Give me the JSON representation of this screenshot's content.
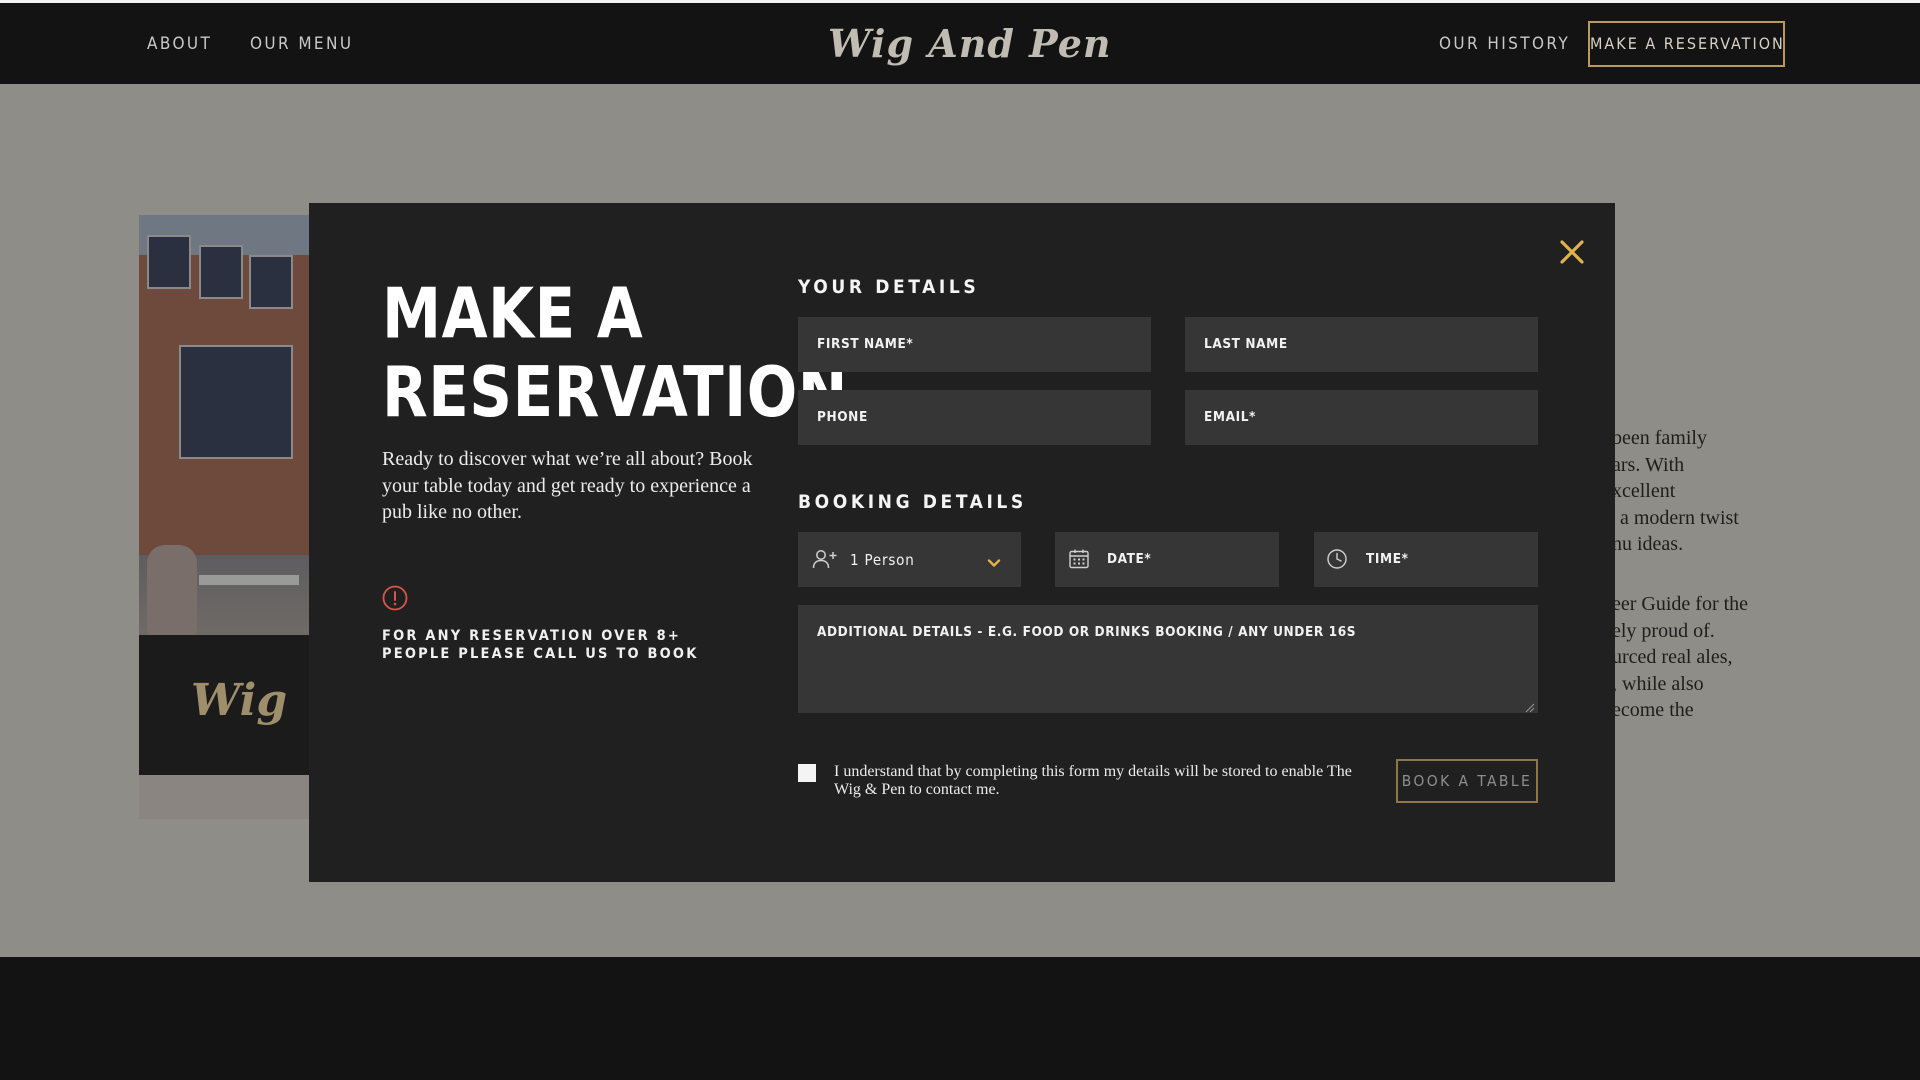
{
  "nav": {
    "left_links": [
      "ABOUT",
      "OUR MENU"
    ],
    "logo_text": "Wig And Pen",
    "right_link": "OUR HISTORY",
    "cta_label": "MAKE A RESERVATION"
  },
  "background": {
    "photo_sign_text": "Wig",
    "paragraph_1": [
      "been family",
      "ars. With",
      "xcellent",
      "a modern twist",
      "nu ideas."
    ],
    "paragraph_2": [
      "eer Guide for the",
      "ely proud of.",
      "urced real ales,",
      ", while also",
      "ecome the"
    ]
  },
  "modal": {
    "title_lines": [
      "MAKE A",
      "RESERVATION"
    ],
    "description": "Ready to discover what we’re all about? Book your table today and get ready to experience a pub like no other.",
    "warning": "FOR ANY RESERVATION OVER 8+ PEOPLE PLEASE CALL US TO BOOK",
    "your_details_heading": "YOUR DETAILS",
    "fields": {
      "first_name": "FIRST NAME*",
      "last_name": "LAST NAME",
      "phone": "PHONE",
      "email": "EMAIL*"
    },
    "booking_details_heading": "BOOKING DETAILS",
    "booking": {
      "party_size": "1 Person",
      "date": "DATE*",
      "time": "TIME*",
      "additional": "ADDITIONAL DETAILS - E.G. FOOD OR DRINKS BOOKING / ANY UNDER 16S"
    },
    "consent_text": "I understand that by completing this form my details will be stored to enable The Wig & Pen to contact me.",
    "submit_label": "BOOK A TABLE"
  },
  "colors": {
    "accent_gold": "#e0b24a",
    "button_border": "#b99b5d",
    "warning_red": "#d9554a",
    "modal_bg": "#202020",
    "field_bg": "#363636"
  }
}
